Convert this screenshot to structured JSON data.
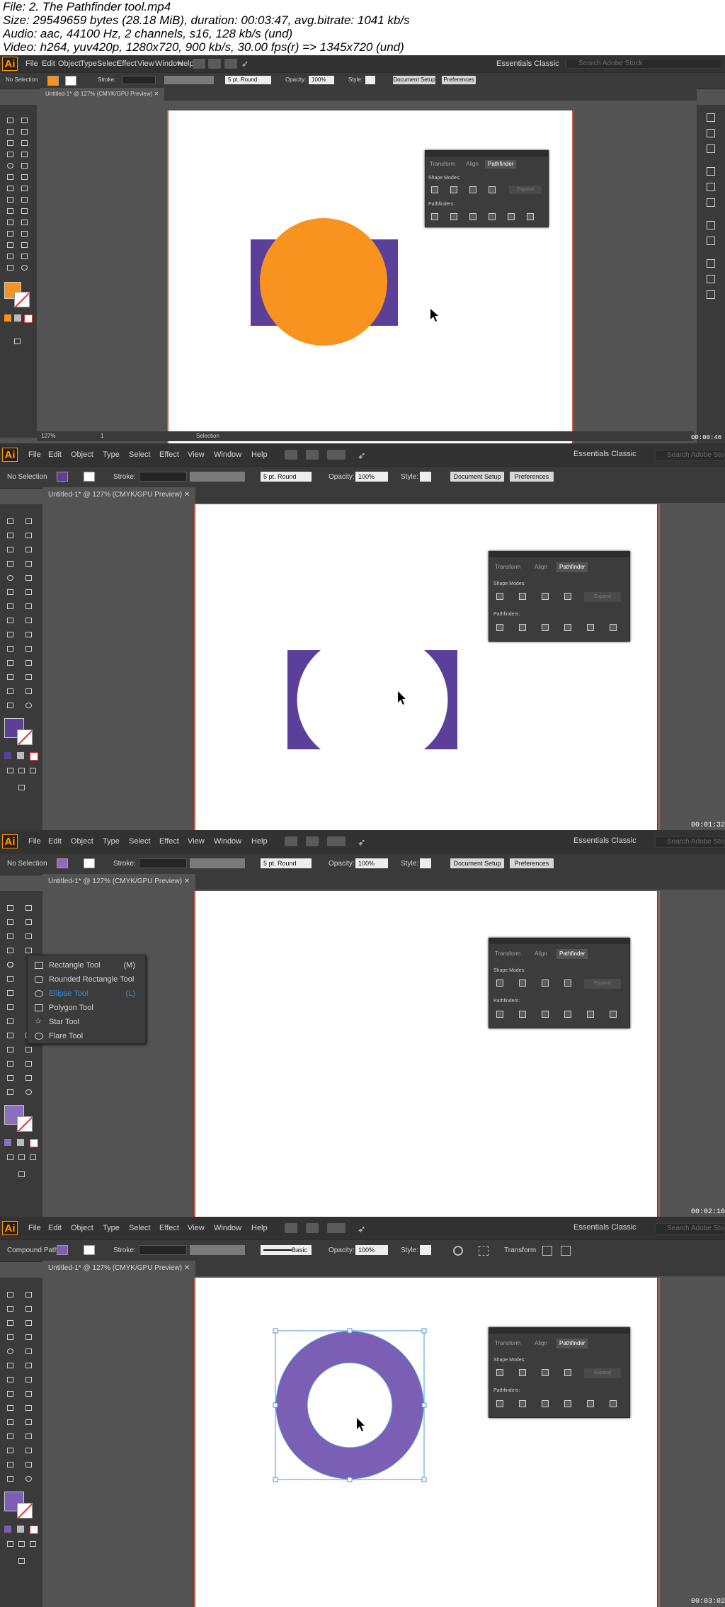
{
  "file_info": {
    "line1": "File: 2. The Pathfinder tool.mp4",
    "line2": "Size: 29549659 bytes (28.18 MiB), duration: 00:03:47, avg.bitrate: 1041 kb/s",
    "line3": "Audio: aac, 44100 Hz, 2 channels, s16, 128 kb/s (und)",
    "line4": "Video: h264, yuv420p, 1280x720, 900 kb/s, 30.00 fps(r) => 1345x720 (und)"
  },
  "menu": {
    "logo": "Ai",
    "items": [
      "File",
      "Edit",
      "Object",
      "Type",
      "Select",
      "Effect",
      "View",
      "Window",
      "Help"
    ],
    "workspace": "Essentials Classic",
    "search_placeholder": "Search Adobe Stock"
  },
  "control": {
    "stroke_label": "Stroke:",
    "brush": "5 pt. Round",
    "opacity_label": "Opacity:",
    "opacity_value": "100%",
    "style_label": "Style:",
    "document_setup": "Document Setup",
    "preferences": "Preferences",
    "basic_label": "Basic",
    "transform_label": "Transform"
  },
  "document_tab": "Untitled-1* @ 127% (CMYK/GPU Preview)",
  "pathfinder": {
    "tabs": [
      "Transform",
      "Align",
      "Pathfinder"
    ],
    "shape_modes": "Shape Modes:",
    "pathfinders": "Pathfinders:",
    "expand": "Expand"
  },
  "status": {
    "zoom": "127%",
    "page": "1",
    "tool": "Selection"
  },
  "frames": [
    {
      "selection_label": "No Selection",
      "fill_color": "#f7931e",
      "timestamp": "00:00:46"
    },
    {
      "selection_label": "No Selection",
      "fill_color": "#5b3f99",
      "timestamp": "00:01:32"
    },
    {
      "selection_label": "No Selection",
      "fill_color": "#8a6fc0",
      "timestamp": "00:02:16"
    },
    {
      "selection_label": "Compound Path",
      "fill_color": "#7b5fb5",
      "timestamp": "00:03:02"
    }
  ],
  "flyout": {
    "items": [
      {
        "label": "Rectangle Tool",
        "key": "(M)"
      },
      {
        "label": "Rounded Rectangle Tool",
        "key": ""
      },
      {
        "label": "Ellipse Tool",
        "key": "(L)"
      },
      {
        "label": "Polygon Tool",
        "key": ""
      },
      {
        "label": "Star Tool",
        "key": ""
      },
      {
        "label": "Flare Tool",
        "key": ""
      }
    ]
  },
  "colors": {
    "orange": "#f7931e",
    "purple_dark": "#5b3f99",
    "purple_ring": "#7b5fb5",
    "selection_blue": "#4a90d9",
    "ui_dark": "#323232",
    "ui_mid": "#535353"
  }
}
